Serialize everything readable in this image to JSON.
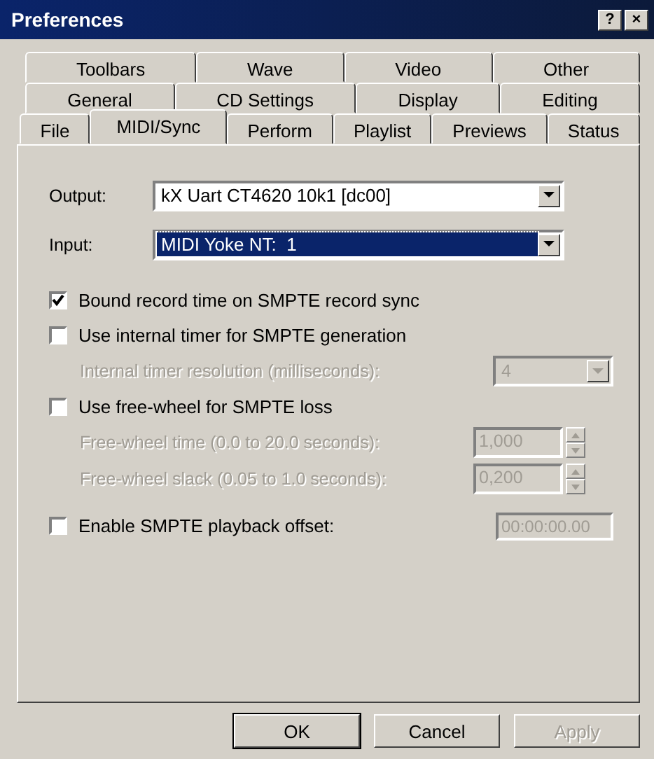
{
  "window": {
    "title": "Preferences",
    "help": "?",
    "close": "×"
  },
  "tab_rows": [
    [
      {
        "label": "Toolbars",
        "selected": false
      },
      {
        "label": "Wave",
        "selected": false
      },
      {
        "label": "Video",
        "selected": false
      },
      {
        "label": "Other",
        "selected": false
      }
    ],
    [
      {
        "label": "General",
        "selected": false
      },
      {
        "label": "CD Settings",
        "selected": false
      },
      {
        "label": "Display",
        "selected": false
      },
      {
        "label": "Editing",
        "selected": false
      }
    ],
    [
      {
        "label": "File",
        "selected": false
      },
      {
        "label": "MIDI/Sync",
        "selected": true
      },
      {
        "label": "Perform",
        "selected": false
      },
      {
        "label": "Playlist",
        "selected": false
      },
      {
        "label": "Previews",
        "selected": false
      },
      {
        "label": "Status",
        "selected": false
      }
    ]
  ],
  "settings": [
    {
      "kind": "combo",
      "label": "Output:",
      "value": "kX Uart CT4620 10k1 [dc00]",
      "focused": false
    },
    {
      "kind": "combo",
      "label": "Input:",
      "value": "MIDI Yoke NT:  1",
      "focused": true
    },
    {
      "kind": "checkbox",
      "label": "Bound record time on SMPTE record sync",
      "checked": true
    },
    {
      "kind": "checkbox",
      "label": "Use internal timer for SMPTE generation",
      "checked": false
    },
    {
      "kind": "dropdown",
      "label": "Internal timer resolution (milliseconds):",
      "value": "4",
      "disabled": true
    },
    {
      "kind": "checkbox",
      "label": "Use free-wheel for SMPTE loss",
      "checked": false
    },
    {
      "kind": "spin",
      "label": "Free-wheel time (0.0 to 20.0 seconds):",
      "value": "1,000",
      "disabled": true
    },
    {
      "kind": "spin",
      "label": "Free-wheel slack (0.05 to 1.0 seconds):",
      "value": "0,200",
      "disabled": true
    },
    {
      "kind": "checkbox_field",
      "label": "Enable SMPTE playback offset:",
      "checked": false,
      "value": "00:00:00.00",
      "disabled": true
    }
  ],
  "buttons": [
    {
      "label": "OK",
      "default": true,
      "disabled": false
    },
    {
      "label": "Cancel",
      "default": false,
      "disabled": false
    },
    {
      "label": "Apply",
      "default": false,
      "disabled": true
    }
  ]
}
